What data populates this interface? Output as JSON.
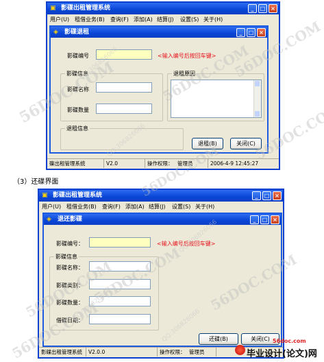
{
  "top_app": {
    "title": "影碟出租管理系统",
    "menu": [
      "用户(U)",
      "租借业务(B)",
      "查询(F)",
      "添加(A)",
      "结算(J)",
      "设置(S)",
      "关于(H)"
    ],
    "dialog": {
      "title": "影碟退租",
      "disc_id_label": "影碟编号",
      "disc_id_hint": "<输入编号后按回车键>",
      "info_group_title": "影碟信息",
      "name_label": "影碟名称",
      "qty_label": "影碟数量",
      "reason_group_title": "退租原因",
      "return_info_title": "退租信息",
      "return_button": "退租(B)",
      "close_button": "关闭(C)"
    },
    "status": {
      "app": "碟出租管理系统",
      "version": "V2.0",
      "permission": "操作权限：",
      "role": "管理员",
      "datetime": "2006-4-9 12:45:27"
    }
  },
  "caption": "（3）还碟界面",
  "bottom_app": {
    "title": "影碟出租管理系统",
    "menu": [
      "用户(U)",
      "租借业务(B)",
      "查询(F)",
      "添加(A)",
      "结算(J)",
      "设置(S)",
      "关于(H)"
    ],
    "dialog": {
      "title": "退还影碟",
      "disc_id_label": "影碟编号：",
      "disc_id_hint": "<输入编号后按回车键>",
      "info_group_title": "影碟信息",
      "name_label": "影碟名称：",
      "type_label": "影碟类别：",
      "qty_label": "影碟数量：",
      "borrow_date_label": "借碟日期：",
      "return_button": "还碟(B)",
      "close_button": "关闭(C)"
    },
    "status": {
      "app": "影碟出租管理系统",
      "version": "V2.0.0",
      "permission": "操作权限：",
      "role": "管理员"
    }
  },
  "watermarks": {
    "brand": "56DOC.COM",
    "qq": "QQ:306826066"
  },
  "footer_logo": {
    "url": "56doc.com",
    "name": "毕业设计(论文)网"
  }
}
